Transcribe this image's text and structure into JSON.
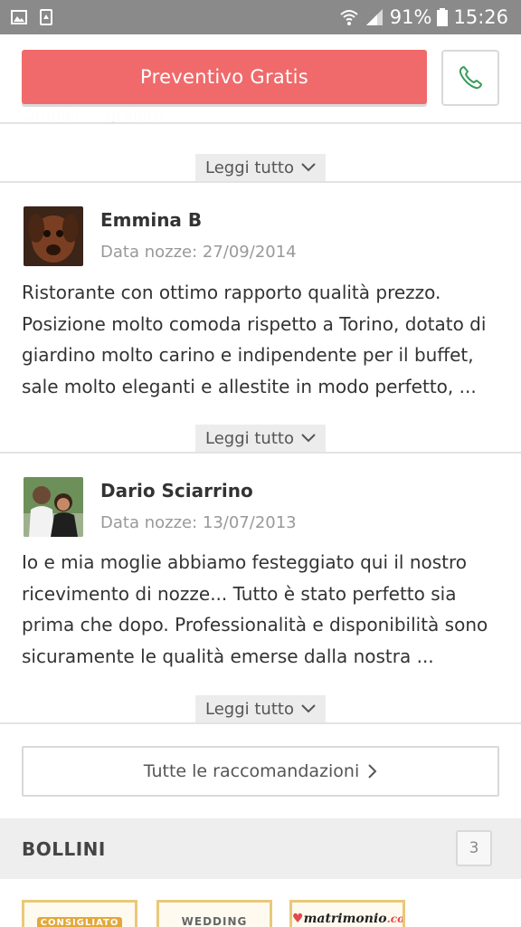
{
  "status_bar": {
    "battery_percent": "91%",
    "time": "15:26",
    "icons": [
      "image-icon",
      "recycle-icon",
      "wifi-icon",
      "signal-icon",
      "battery-icon"
    ]
  },
  "action_bar": {
    "quote_button": "Preventivo Gratis",
    "phone_icon": "phone-icon"
  },
  "previous_review": {
    "read_more": "Leggi tutto"
  },
  "reviews": [
    {
      "name": "Emmina B",
      "wedding_date": "Data nozze: 27/09/2014",
      "text": "Ristorante con ottimo rapporto qualità prezzo. Posizione molto comoda rispetto a Torino, dotato di giardino molto carino e indipendente per il buffet, sale molto eleganti e allestite in modo perfetto, ...",
      "read_more": "Leggi tutto"
    },
    {
      "name": "Dario Sciarrino",
      "wedding_date": "Data nozze: 13/07/2013",
      "text": "Io e mia moglie abbiamo festeggiato qui il nostro ricevimento di nozze... Tutto è stato perfetto sia prima che dopo. Professionalità e disponibilità sono sicuramente le qualità emerse dalla nostra ...",
      "read_more": "Leggi tutto"
    }
  ],
  "all_recommendations": "Tutte le raccomandazioni",
  "bollini": {
    "title": "BOLLINI",
    "count": "3",
    "badges": [
      {
        "label": "CONSIGLIATO"
      },
      {
        "label": "WEDDING"
      },
      {
        "label": "matrimonio",
        "suffix": ".com"
      }
    ]
  },
  "colors": {
    "accent": "#f06a6b",
    "phone_icon": "#3a9c5a",
    "status_bar": "#8a8a8a",
    "badge_gold": "#e9c879"
  }
}
